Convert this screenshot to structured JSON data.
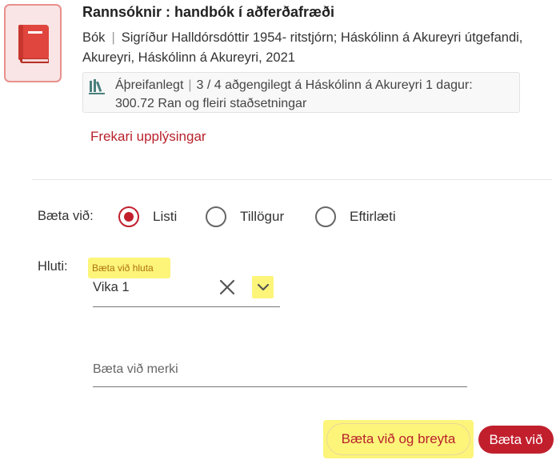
{
  "record": {
    "title": "Rannsóknir : handbók í aðferðafræði",
    "type": "Bók",
    "contributors": "Sigríður Halldórsdóttir 1954- ritstjórn; Háskólinn á Akureyri útgefandi, Akureyri, Háskólinn á Akureyri, 2021",
    "availability_status": "Áþreifanlegt",
    "availability_detail": "3 / 4 aðgengilegt á Háskólinn á Akureyri 1 dagur: 300.72 Ran og fleiri staðsetningar",
    "more_info_link": "Frekari upplýsingar"
  },
  "form": {
    "add_to_label": "Bæta við:",
    "radio_options": [
      {
        "label": "Listi",
        "selected": true
      },
      {
        "label": "Tillögur",
        "selected": false
      },
      {
        "label": "Eftirlæti",
        "selected": false
      }
    ],
    "section_label": "Hluti:",
    "section_field_label": "Bæta við hluta",
    "section_value": "Vika 1",
    "tags_placeholder": "Bæta við merki"
  },
  "actions": {
    "add_and_edit": "Bæta við og breyta",
    "add": "Bæta við"
  },
  "colors": {
    "accent": "#c21f2d",
    "highlight": "#fcf57a"
  },
  "icons": {
    "record_type": "book-icon",
    "availability": "library-books-icon",
    "clear": "close-x-icon",
    "dropdown": "chevron-down-icon"
  }
}
